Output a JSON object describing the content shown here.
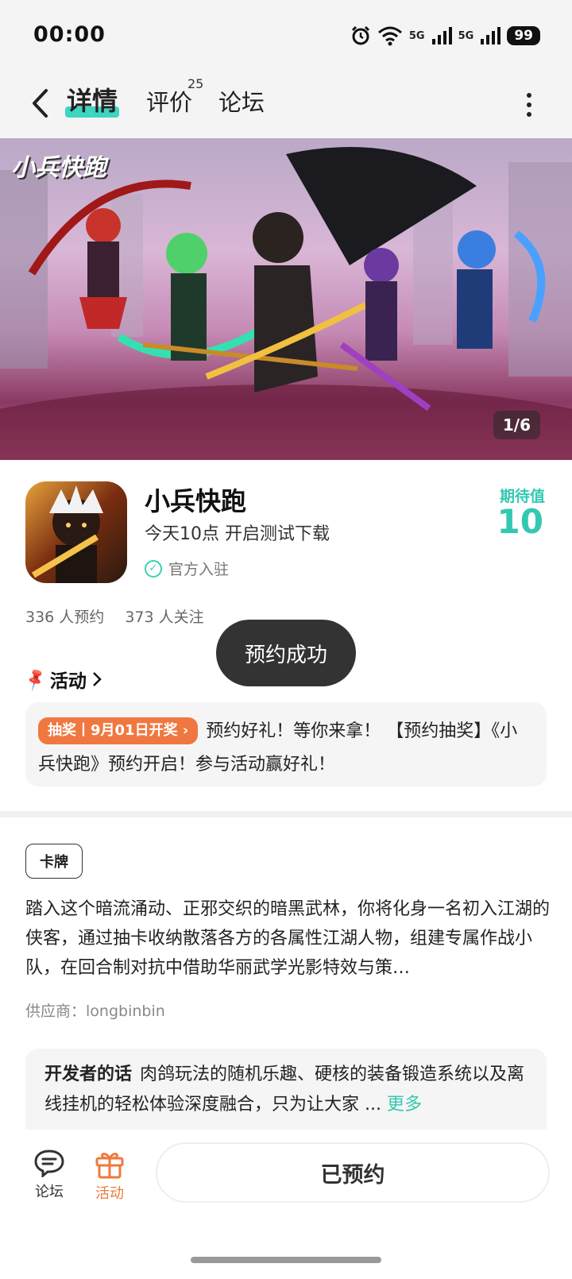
{
  "status_bar": {
    "time": "00:00",
    "battery": "99",
    "network_1": "5G",
    "network_2": "5G",
    "wifi_level": "6"
  },
  "nav": {
    "tabs": [
      {
        "label": "详情"
      },
      {
        "label": "评价",
        "count": "25"
      },
      {
        "label": "论坛"
      }
    ]
  },
  "banner": {
    "logo_text": "小兵快跑",
    "counter": "1/6"
  },
  "app": {
    "name": "小兵快跑",
    "subtitle": "今天10点 开启测试下载",
    "official_label": "官方入驻",
    "expect_label": "期待值",
    "expect_value": "10",
    "reservations": "336 人预约",
    "followers": "373 人关注"
  },
  "toast": "预约成功",
  "activity": {
    "header": "活动",
    "tag": "抽奖丨9月01日开奖",
    "text": "预约好礼！等你来拿！ 【预约抽奖】《小兵快跑》预约开启！参与活动赢好礼！"
  },
  "genre_tag": "卡牌",
  "description": "踏入这个暗流涌动、正邪交织的暗黑武林，你将化身一名初入江湖的侠客，通过抽卡收纳散落各方的各属性江湖人物，组建专属作战小队，在回合制对抗中借助华丽武学光影特效与策…",
  "supplier": "供应商：longbinbin",
  "developer": {
    "title": "开发者的话",
    "text": "肉鸽玩法的随机乐趣、硬核的装备锻造系统以及离线挂机的轻松体验深度融合，只为让大家 ...",
    "more": "更多"
  },
  "bottom": {
    "forum_label": "论坛",
    "activity_label": "活动",
    "reserved_label": "已预约"
  },
  "colors": {
    "accent": "#34c8b2",
    "orange": "#f07840"
  }
}
